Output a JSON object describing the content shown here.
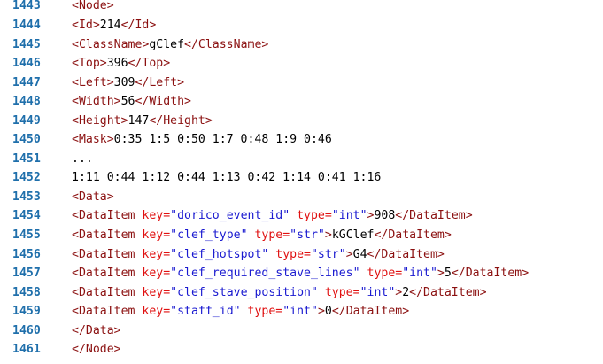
{
  "lines": [
    {
      "n": "1443",
      "tokens": [
        [
          "t",
          "<Node>"
        ]
      ]
    },
    {
      "n": "1444",
      "tokens": [
        [
          "t",
          "<Id>"
        ],
        [
          "x",
          "214"
        ],
        [
          "t",
          "</Id>"
        ]
      ]
    },
    {
      "n": "1445",
      "tokens": [
        [
          "t",
          "<ClassName>"
        ],
        [
          "x",
          "gClef"
        ],
        [
          "t",
          "</ClassName>"
        ]
      ]
    },
    {
      "n": "1446",
      "tokens": [
        [
          "t",
          "<Top>"
        ],
        [
          "x",
          "396"
        ],
        [
          "t",
          "</Top>"
        ]
      ]
    },
    {
      "n": "1447",
      "tokens": [
        [
          "t",
          "<Left>"
        ],
        [
          "x",
          "309"
        ],
        [
          "t",
          "</Left>"
        ]
      ]
    },
    {
      "n": "1448",
      "tokens": [
        [
          "t",
          "<Width>"
        ],
        [
          "x",
          "56"
        ],
        [
          "t",
          "</Width>"
        ]
      ]
    },
    {
      "n": "1449",
      "tokens": [
        [
          "t",
          "<Height>"
        ],
        [
          "x",
          "147"
        ],
        [
          "t",
          "</Height>"
        ]
      ]
    },
    {
      "n": "1450",
      "tokens": [
        [
          "t",
          "<Mask>"
        ],
        [
          "x",
          "0:35 1:5 0:50 1:7 0:48 1:9 0:46"
        ]
      ]
    },
    {
      "n": "1451",
      "tokens": [
        [
          "x",
          "..."
        ]
      ]
    },
    {
      "n": "1452",
      "tokens": [
        [
          "x",
          "1:11 0:44 1:12 0:44 1:13 0:42 1:14 0:41 1:16"
        ]
      ]
    },
    {
      "n": "1453",
      "tokens": [
        [
          "t",
          "<Data>"
        ]
      ]
    },
    {
      "n": "1454",
      "tokens": [
        [
          "t",
          "<DataItem "
        ],
        [
          "k",
          "key="
        ],
        [
          "s",
          "\"dorico_event_id\""
        ],
        [
          "x",
          " "
        ],
        [
          "k",
          "type="
        ],
        [
          "s",
          "\"int\""
        ],
        [
          "t",
          ">"
        ],
        [
          "x",
          "908"
        ],
        [
          "t",
          "</DataItem>"
        ]
      ]
    },
    {
      "n": "1455",
      "tokens": [
        [
          "t",
          "<DataItem "
        ],
        [
          "k",
          "key="
        ],
        [
          "s",
          "\"clef_type\""
        ],
        [
          "x",
          " "
        ],
        [
          "k",
          "type="
        ],
        [
          "s",
          "\"str\""
        ],
        [
          "t",
          ">"
        ],
        [
          "x",
          "kGClef"
        ],
        [
          "t",
          "</DataItem>"
        ]
      ]
    },
    {
      "n": "1456",
      "tokens": [
        [
          "t",
          "<DataItem "
        ],
        [
          "k",
          "key="
        ],
        [
          "s",
          "\"clef_hotspot\""
        ],
        [
          "x",
          " "
        ],
        [
          "k",
          "type="
        ],
        [
          "s",
          "\"str\""
        ],
        [
          "t",
          ">"
        ],
        [
          "x",
          "G4"
        ],
        [
          "t",
          "</DataItem>"
        ]
      ]
    },
    {
      "n": "1457",
      "tokens": [
        [
          "t",
          "<DataItem "
        ],
        [
          "k",
          "key="
        ],
        [
          "s",
          "\"clef_required_stave_lines\""
        ],
        [
          "x",
          " "
        ],
        [
          "k",
          "type="
        ],
        [
          "s",
          "\"int\""
        ],
        [
          "t",
          ">"
        ],
        [
          "x",
          "5"
        ],
        [
          "t",
          "</DataItem>"
        ]
      ]
    },
    {
      "n": "1458",
      "tokens": [
        [
          "t",
          "<DataItem "
        ],
        [
          "k",
          "key="
        ],
        [
          "s",
          "\"clef_stave_position\""
        ],
        [
          "x",
          " "
        ],
        [
          "k",
          "type="
        ],
        [
          "s",
          "\"int\""
        ],
        [
          "t",
          ">"
        ],
        [
          "x",
          "2"
        ],
        [
          "t",
          "</DataItem>"
        ]
      ]
    },
    {
      "n": "1459",
      "tokens": [
        [
          "t",
          "<DataItem "
        ],
        [
          "k",
          "key="
        ],
        [
          "s",
          "\"staff_id\""
        ],
        [
          "x",
          " "
        ],
        [
          "k",
          "type="
        ],
        [
          "s",
          "\"int\""
        ],
        [
          "t",
          ">"
        ],
        [
          "x",
          "0"
        ],
        [
          "t",
          "</DataItem>"
        ]
      ]
    },
    {
      "n": "1460",
      "tokens": [
        [
          "t",
          "</Data>"
        ]
      ]
    },
    {
      "n": "1461",
      "tokens": [
        [
          "t",
          "</Node>"
        ]
      ]
    }
  ]
}
